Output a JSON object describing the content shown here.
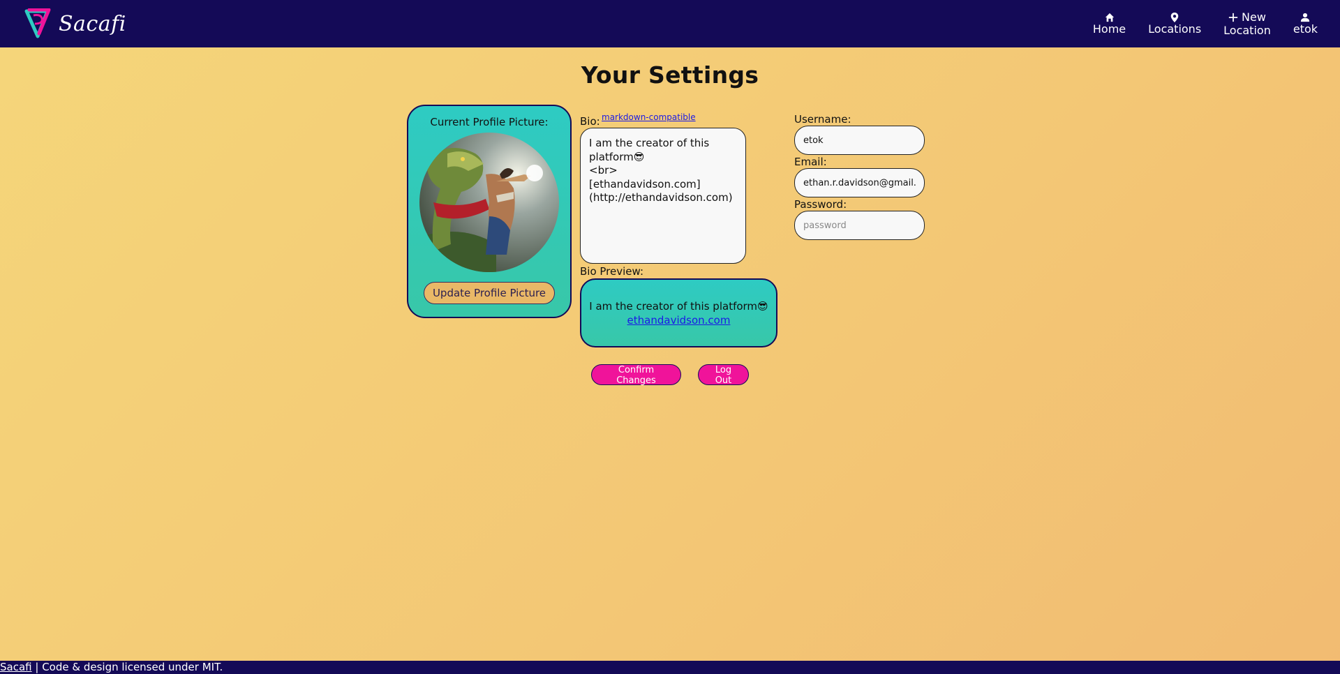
{
  "header": {
    "brand": "Sacafi",
    "nav": [
      {
        "label": "Home",
        "icon": "home-icon"
      },
      {
        "label": "Locations",
        "icon": "map-pin-icon"
      },
      {
        "label_line1": "New",
        "label_line2": "Location",
        "icon": "plus-icon"
      },
      {
        "label": "etok",
        "icon": "user-icon"
      }
    ]
  },
  "page": {
    "title": "Your Settings"
  },
  "profile": {
    "label": "Current Profile Picture:",
    "update_button": "Update Profile Picture"
  },
  "bio": {
    "label": "Bio:",
    "markdown_link": "markdown-compatible",
    "value": "I am the creator of this platform😎\n<br>\n[ethandavidson.com](http://ethandavidson.com)",
    "preview_label": "Bio Preview:",
    "preview_text": "I am the creator of this platform😎",
    "preview_link": "ethandavidson.com"
  },
  "account": {
    "username_label": "Username:",
    "username_value": "etok",
    "email_label": "Email:",
    "email_value": "ethan.r.davidson@gmail.com",
    "password_label": "Password:",
    "password_placeholder": "password"
  },
  "actions": {
    "confirm": "Confirm Changes",
    "logout": "Log Out"
  },
  "footer": {
    "link": "Sacafi",
    "separator": " | ",
    "text": "Code & design licensed under MIT."
  },
  "colors": {
    "header_bg": "#140a57",
    "card_teal": "#2ecbc3",
    "accent_pink": "#f0139a",
    "page_bg": "#f5d67a"
  }
}
